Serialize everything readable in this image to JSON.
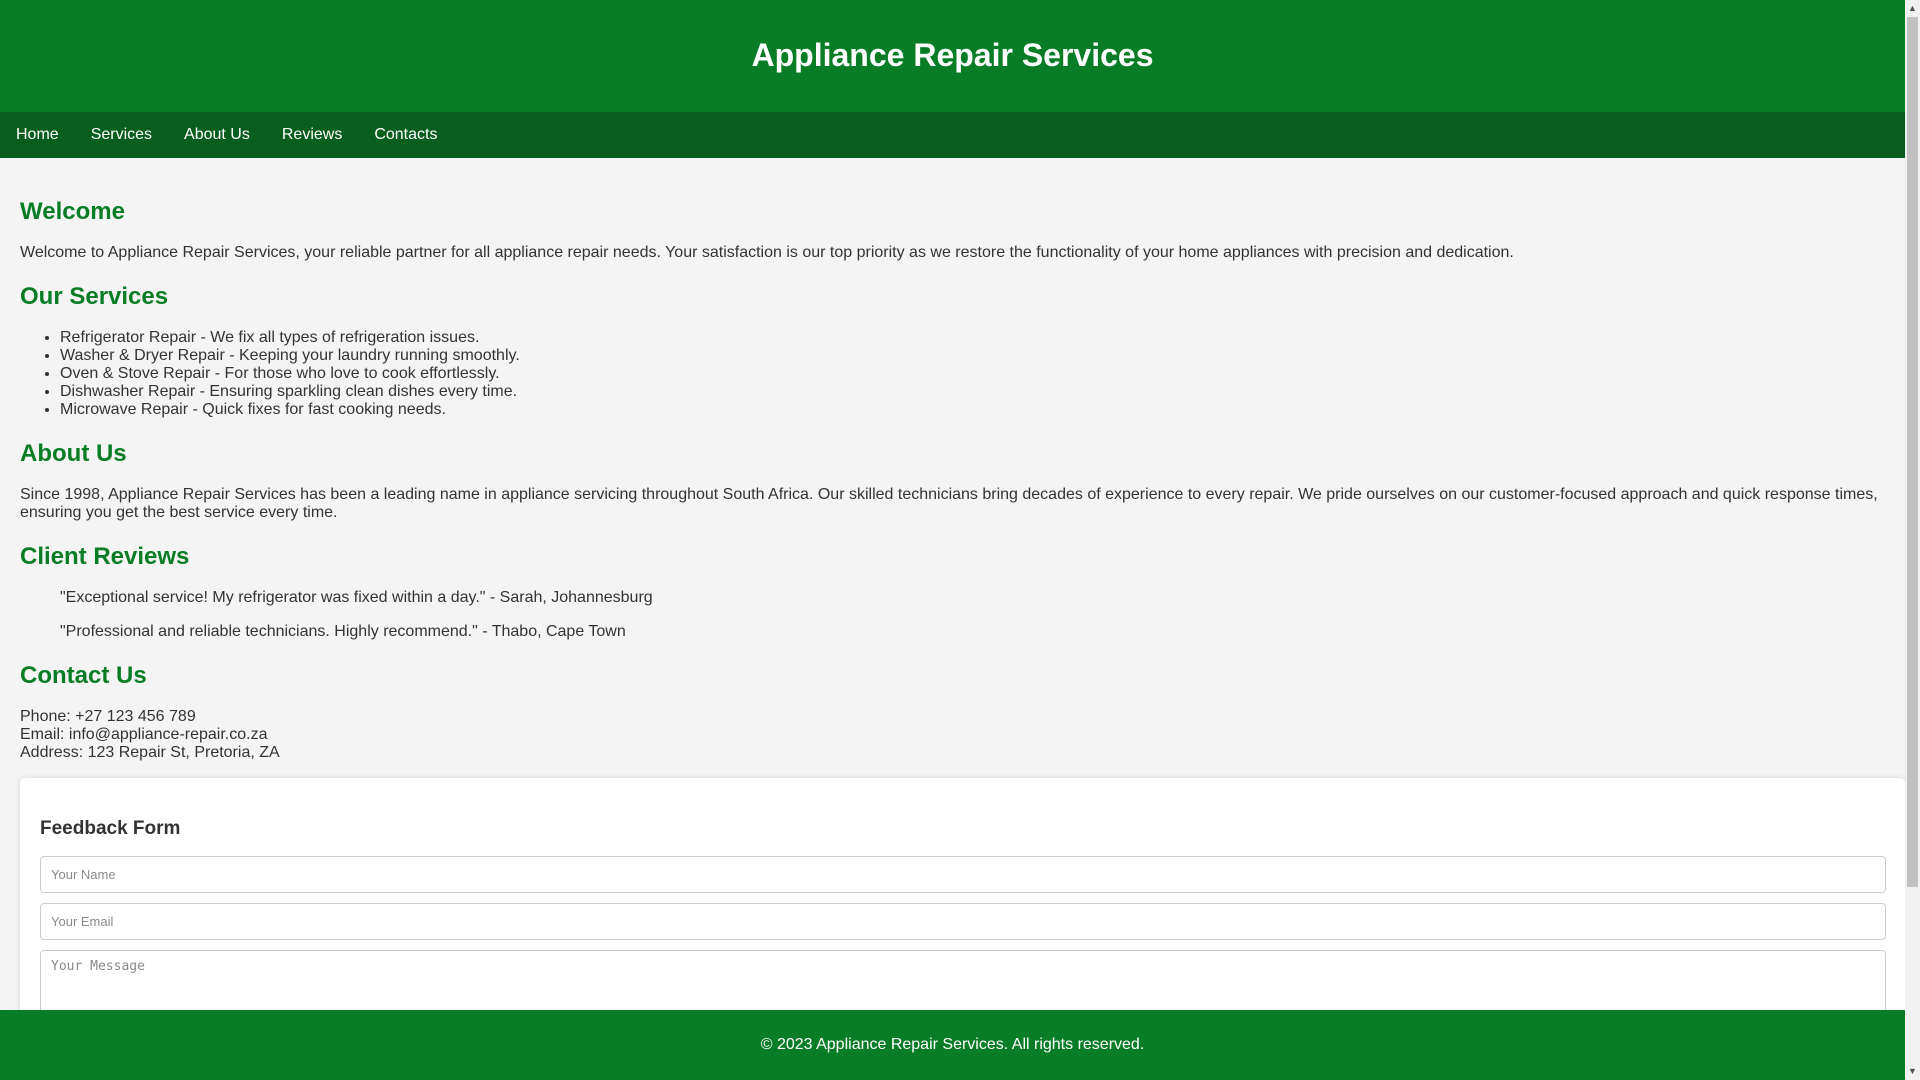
{
  "header": {
    "title": "Appliance Repair Services"
  },
  "nav": {
    "items": [
      "Home",
      "Services",
      "About Us",
      "Reviews",
      "Contacts"
    ]
  },
  "welcome": {
    "heading": "Welcome",
    "text": "Welcome to Appliance Repair Services, your reliable partner for all appliance repair needs. Your satisfaction is our top priority as we restore the functionality of your home appliances with precision and dedication."
  },
  "services": {
    "heading": "Our Services",
    "items": [
      "Refrigerator Repair - We fix all types of refrigeration issues.",
      "Washer & Dryer Repair - Keeping your laundry running smoothly.",
      "Oven & Stove Repair - For those who love to cook effortlessly.",
      "Dishwasher Repair - Ensuring sparkling clean dishes every time.",
      "Microwave Repair - Quick fixes for fast cooking needs."
    ]
  },
  "about": {
    "heading": "About Us",
    "text": "Since 1998, Appliance Repair Services has been a leading name in appliance servicing throughout South Africa. Our skilled technicians bring decades of experience to every repair. We pride ourselves on our customer-focused approach and quick response times, ensuring you get the best service every time."
  },
  "reviews": {
    "heading": "Client Reviews",
    "items": [
      "\"Exceptional service! My refrigerator was fixed within a day.\" - Sarah, Johannesburg",
      "\"Professional and reliable technicians. Highly recommend.\" - Thabo, Cape Town"
    ]
  },
  "contact": {
    "heading": "Contact Us",
    "phone": "Phone: +27 123 456 789",
    "email": "Email: info@appliance-repair.co.za",
    "address": "Address: 123 Repair St, Pretoria, ZA"
  },
  "feedback": {
    "heading": "Feedback Form",
    "name_placeholder": "Your Name",
    "email_placeholder": "Your Email",
    "message_placeholder": "Your Message"
  },
  "footer": {
    "text": "© 2023 Appliance Repair Services. All rights reserved."
  },
  "colors": {
    "header_green": "#087d26",
    "nav_green": "#075e1d",
    "background": "#f4f4f4"
  }
}
